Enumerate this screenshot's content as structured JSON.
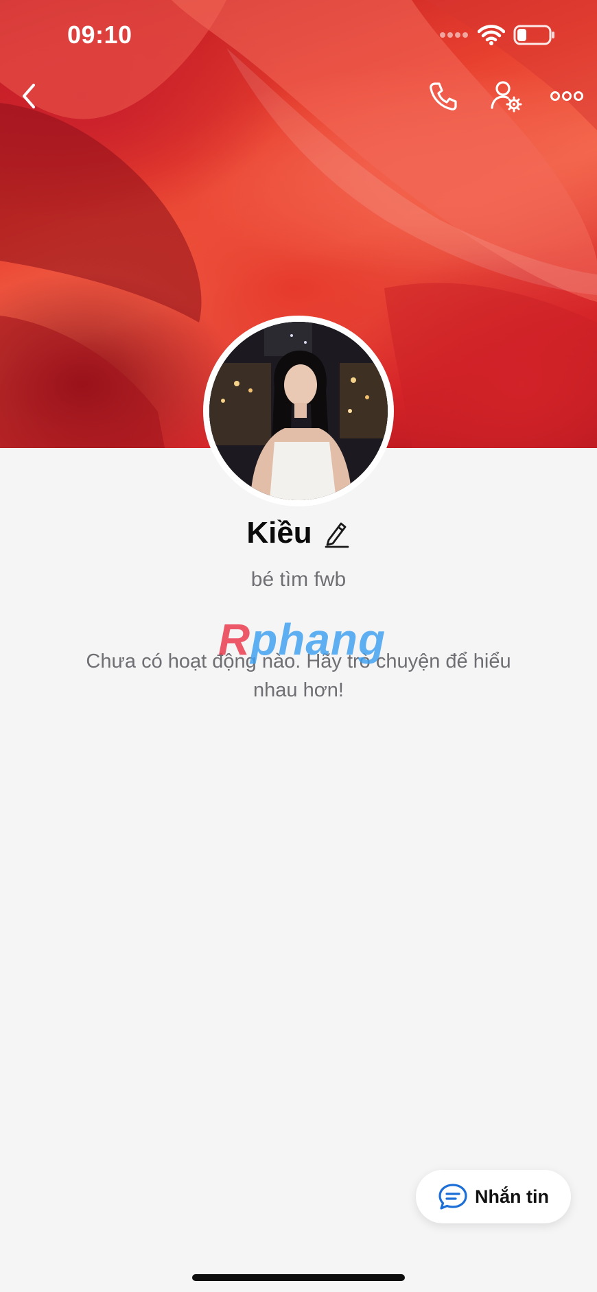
{
  "status_bar": {
    "time": "09:10",
    "icons": [
      "signal-dots-icon",
      "wifi-icon",
      "battery-icon"
    ],
    "battery_level": 0.3
  },
  "header": {
    "icons": [
      "back-icon",
      "phone-icon",
      "user-settings-icon",
      "more-icon"
    ]
  },
  "profile": {
    "name": "Kiều",
    "edit_icon": "pencil-icon",
    "bio": "bé tìm fwb"
  },
  "watermark": {
    "first": "R",
    "rest": "phang"
  },
  "feed": {
    "empty_message": "Chưa có hoạt động nào. Hãy trò chuyện để hiểu nhau hơn!"
  },
  "actions": {
    "message_label": "Nhắn tin",
    "message_icon": "chat-bubble-icon"
  },
  "colors": {
    "background": "#f5f5f6",
    "cover_red": "#e8402f",
    "message_icon_blue": "#1d6fd8"
  }
}
